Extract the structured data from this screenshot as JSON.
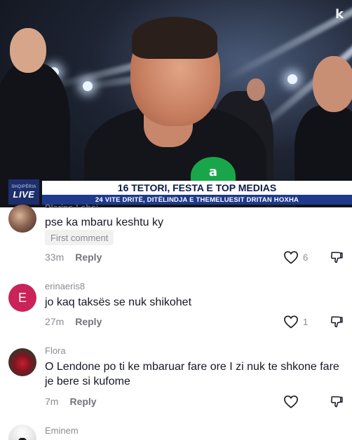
{
  "video": {
    "channel_logo_top": "SHQIPËRIA",
    "channel_logo_live": "LIVE",
    "headline": "16 TETORI, FESTA E TOP MEDIAS",
    "subline": "24 VITE DRITË, DITËLINDJA E THEMELUESIT DRITAN HOXHA",
    "corner_logo": "k",
    "mic_label": "a"
  },
  "comments": [
    {
      "username": "Blerina Labaj",
      "text": "pse ka mbaru keshtu ky",
      "badge": "First comment",
      "time": "33m",
      "reply_label": "Reply",
      "likes": "6"
    },
    {
      "username": "erinaeris8",
      "avatar_letter": "E",
      "text": "jo kaq taksës se nuk shikohet",
      "time": "27m",
      "reply_label": "Reply",
      "likes": "1"
    },
    {
      "username": "Flora",
      "text": "O Lendone po ti ke mbaruar fare ore I zi nuk te shkone fare je bere si kufome",
      "time": "7m",
      "reply_label": "Reply",
      "likes": ""
    },
    {
      "username": "Eminem"
    }
  ],
  "colors": {
    "avatar_letter_bg": "#c9235a",
    "lowerthird_blue": "#1f3a8c",
    "muted_text": "#8a8b91"
  },
  "icons": {
    "like": "heart-outline-icon",
    "dislike": "thumbs-down-outline-icon"
  }
}
